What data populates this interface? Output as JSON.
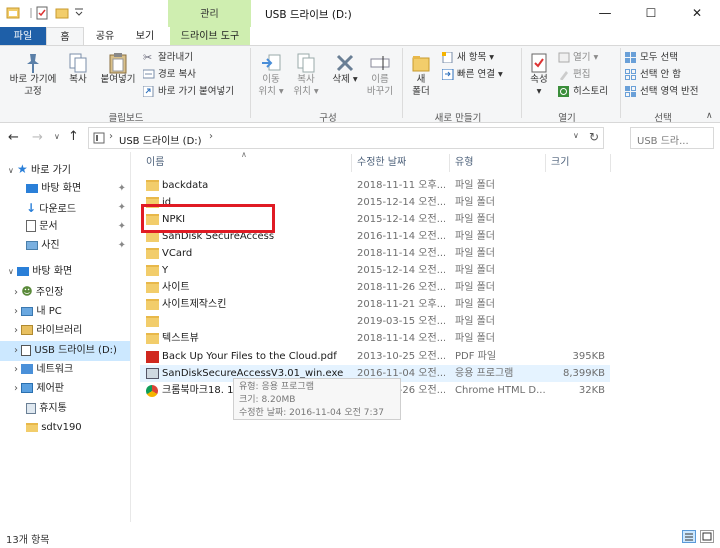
{
  "window": {
    "context_tab": "관리",
    "title": "USB 드라이브 (D:)",
    "min_glyph": "—",
    "max_glyph": "☐",
    "close_glyph": "✕"
  },
  "ribbon_tabs": {
    "file": "파일",
    "home": "홈",
    "share": "공유",
    "view": "보기",
    "drive_tools": "드라이브 도구"
  },
  "ribbon": {
    "pin": [
      "바로 가기에",
      "고정"
    ],
    "copy": "복사",
    "paste": "붙여넣기",
    "cut": "잘라내기",
    "copy_path": "경로 복사",
    "paste_shortcut": "바로 가기 붙여넣기",
    "clipboard_group": "클립보드",
    "move_to": [
      "이동",
      "위치"
    ],
    "copy_to": [
      "복사",
      "위치"
    ],
    "delete": "삭제",
    "rename": [
      "이름",
      "바꾸기"
    ],
    "organize_group": "구성",
    "new_folder": [
      "새",
      "폴더"
    ],
    "new_item": "새 항목",
    "easy_access": "빠른 연결",
    "new_group": "새로 만들기",
    "properties": "속성",
    "open": "열기",
    "edit": "편집",
    "history": "히스토리",
    "open_group": "열기",
    "select_all": "모두 선택",
    "select_none": "선택 안 함",
    "invert_selection": "선택 영역 반전",
    "select_group": "선택"
  },
  "address": {
    "path": "USB 드라이브 (D:)",
    "search_placeholder": "USB 드라..."
  },
  "nav_pane": {
    "quick_access": "바로 가기",
    "desktop_pinned": "바탕 화면",
    "downloads": "다운로드",
    "documents": "문서",
    "pictures": "사진",
    "desktop": "바탕 화면",
    "user": "주인장",
    "this_pc": "내 PC",
    "libraries": "라이브러리",
    "usb": "USB 드라이브 (D:)",
    "network": "네트워크",
    "control_panel": "제어판",
    "recycle_bin": "휴지통",
    "sdtv": "sdtv190"
  },
  "columns": {
    "name": "이름",
    "modified": "수정한 날짜",
    "type": "유형",
    "size": "크기"
  },
  "files": [
    {
      "name": "backdata",
      "date": "2018-11-11 오후...",
      "type": "파일 폴더",
      "size": "",
      "kind": "folder"
    },
    {
      "name": "id",
      "date": "2015-12-14 오전...",
      "type": "파일 폴더",
      "size": "",
      "kind": "folder"
    },
    {
      "name": "NPKI",
      "date": "2015-12-14 오전...",
      "type": "파일 폴더",
      "size": "",
      "kind": "folder"
    },
    {
      "name": "SanDisk SecureAccess",
      "date": "2016-11-14 오전...",
      "type": "파일 폴더",
      "size": "",
      "kind": "folder"
    },
    {
      "name": "VCard",
      "date": "2018-11-14 오전...",
      "type": "파일 폴더",
      "size": "",
      "kind": "folder"
    },
    {
      "name": "Y",
      "date": "2015-12-14 오전...",
      "type": "파일 폴더",
      "size": "",
      "kind": "folder"
    },
    {
      "name": "사이트",
      "date": "2018-11-26 오전...",
      "type": "파일 폴더",
      "size": "",
      "kind": "folder"
    },
    {
      "name": "사이트제작스킨",
      "date": "2018-11-21 오후...",
      "type": "파일 폴더",
      "size": "",
      "kind": "folder"
    },
    {
      "name": "",
      "date": "2019-03-15 오전...",
      "type": "파일 폴더",
      "size": "",
      "kind": "folder"
    },
    {
      "name": "텍스트뷰",
      "date": "2018-11-14 오전...",
      "type": "파일 폴더",
      "size": "",
      "kind": "folder"
    },
    {
      "name": "Back Up Your Files to the Cloud.pdf",
      "date": "2013-10-25 오전...",
      "type": "PDF 파일",
      "size": "395KB",
      "kind": "pdf"
    },
    {
      "name": "SanDiskSecureAccessV3.01_win.exe",
      "date": "2016-11-04 오전...",
      "type": "응용 프로그램",
      "size": "8,399KB",
      "kind": "exe"
    },
    {
      "name": "크롬북마크18. 11. 26..html",
      "date": "2018-11-26 오전...",
      "type": "Chrome HTML D...",
      "size": "32KB",
      "kind": "chrome"
    }
  ],
  "tooltip": {
    "line1": "유형: 응용 프로그램",
    "line2": "크기: 8.20MB",
    "line3": "수정한 날짜: 2016-11-04 오전 7:37"
  },
  "status": {
    "count": "13개 항목"
  }
}
